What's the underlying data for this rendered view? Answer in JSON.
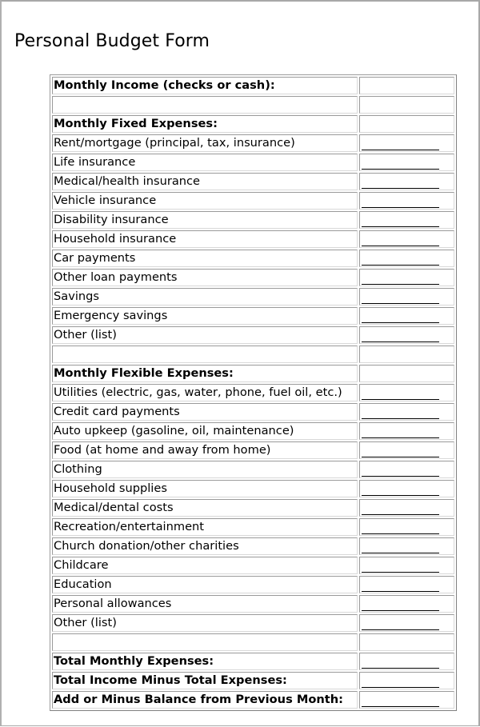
{
  "document": {
    "title": "Personal Budget Form"
  },
  "form": {
    "rows": [
      {
        "label": "Monthly Income (checks or cash):",
        "kind": "heading",
        "has_blank": false
      },
      {
        "label": "",
        "kind": "spacer",
        "has_blank": false
      },
      {
        "label": "Monthly Fixed Expenses:",
        "kind": "heading",
        "has_blank": false
      },
      {
        "label": "Rent/mortgage (principal, tax, insurance)",
        "kind": "item",
        "has_blank": true
      },
      {
        "label": "Life insurance",
        "kind": "item",
        "has_blank": true
      },
      {
        "label": "Medical/health insurance",
        "kind": "item",
        "has_blank": true
      },
      {
        "label": "Vehicle insurance",
        "kind": "item",
        "has_blank": true
      },
      {
        "label": "Disability insurance",
        "kind": "item",
        "has_blank": true
      },
      {
        "label": "Household insurance",
        "kind": "item",
        "has_blank": true
      },
      {
        "label": "Car payments",
        "kind": "item",
        "has_blank": true
      },
      {
        "label": "Other loan payments",
        "kind": "item",
        "has_blank": true
      },
      {
        "label": "Savings",
        "kind": "item",
        "has_blank": true
      },
      {
        "label": "Emergency savings",
        "kind": "item",
        "has_blank": true
      },
      {
        "label": "Other (list)",
        "kind": "item",
        "has_blank": true
      },
      {
        "label": "",
        "kind": "spacer",
        "has_blank": false
      },
      {
        "label": "Monthly Flexible Expenses:",
        "kind": "heading",
        "has_blank": false
      },
      {
        "label": "Utilities (electric, gas, water, phone, fuel oil, etc.)",
        "kind": "item",
        "has_blank": true
      },
      {
        "label": "Credit card payments",
        "kind": "item",
        "has_blank": true
      },
      {
        "label": "Auto upkeep (gasoline, oil, maintenance)",
        "kind": "item",
        "has_blank": true
      },
      {
        "label": "Food (at home and away from home)",
        "kind": "item",
        "has_blank": true
      },
      {
        "label": "Clothing",
        "kind": "item",
        "has_blank": true
      },
      {
        "label": "Household supplies",
        "kind": "item",
        "has_blank": true
      },
      {
        "label": "Medical/dental costs",
        "kind": "item",
        "has_blank": true
      },
      {
        "label": "Recreation/entertainment",
        "kind": "item",
        "has_blank": true
      },
      {
        "label": "Church donation/other charities",
        "kind": "item",
        "has_blank": true
      },
      {
        "label": "Childcare",
        "kind": "item",
        "has_blank": true
      },
      {
        "label": "Education",
        "kind": "item",
        "has_blank": true
      },
      {
        "label": "Personal allowances",
        "kind": "item",
        "has_blank": true
      },
      {
        "label": "Other (list)",
        "kind": "item",
        "has_blank": true
      },
      {
        "label": "",
        "kind": "spacer",
        "has_blank": false
      },
      {
        "label": "Total Monthly Expenses:",
        "kind": "total",
        "has_blank": true
      },
      {
        "label": "Total Income Minus Total Expenses:",
        "kind": "total",
        "has_blank": true
      },
      {
        "label": "Add or Minus Balance from Previous Month:",
        "kind": "total",
        "has_blank": true
      }
    ]
  }
}
